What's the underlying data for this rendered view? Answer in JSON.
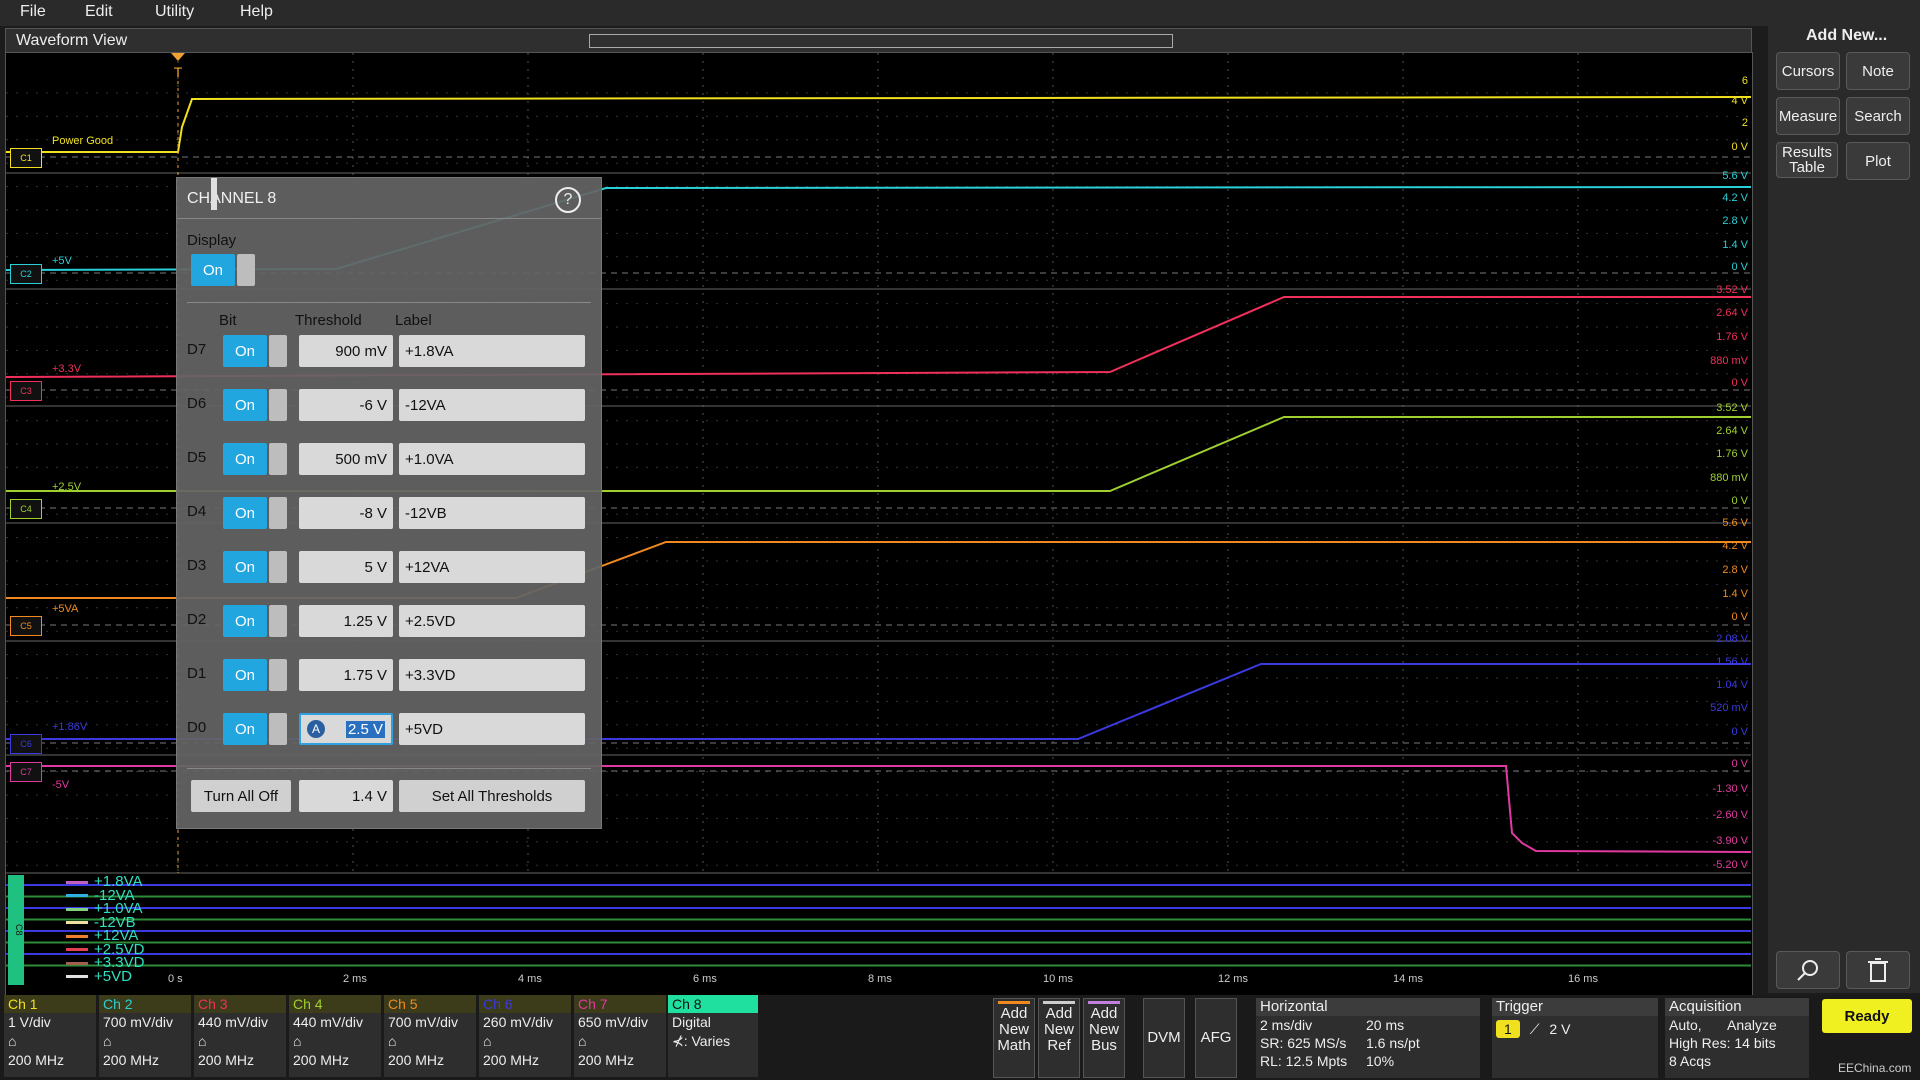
{
  "menu": {
    "items": [
      "File",
      "Edit",
      "Utility",
      "Help"
    ]
  },
  "waveform_view": {
    "title": "Waveform View",
    "trigger_marker": "T",
    "channel_labels": [
      {
        "badge": "C1",
        "name": "Power Good",
        "color": "#f0e020"
      },
      {
        "badge": "C2",
        "name": "+5V",
        "color": "#2ad0d8"
      },
      {
        "badge": "C3",
        "name": "+3.3V",
        "color": "#f0305a"
      },
      {
        "badge": "C4",
        "name": "+2.5V",
        "color": "#9fd030"
      },
      {
        "badge": "C5",
        "name": "+5VA",
        "color": "#f08a20"
      },
      {
        "badge": "C6",
        "name": "+1.86V",
        "color": "#3a3ae0"
      },
      {
        "badge": "C7",
        "name": "-5V",
        "color": "#e03aa0"
      }
    ],
    "scales": [
      [
        "6",
        "4 V",
        "2",
        "0 V"
      ],
      [
        "5.6 V",
        "4.2 V",
        "2.8 V",
        "1.4 V",
        "0 V"
      ],
      [
        "3.52 V",
        "2.64 V",
        "1.76 V",
        "880 mV",
        "0 V"
      ],
      [
        "3.52 V",
        "2.64 V",
        "1.76 V",
        "880 mV",
        "0 V"
      ],
      [
        "5.6 V",
        "4.2 V",
        "2.8 V",
        "1.4 V",
        "0 V"
      ],
      [
        "2.08 V",
        "1.56 V",
        "1.04 V",
        "520 mV",
        "0 V"
      ],
      [
        "0 V",
        "-1.30 V",
        "-2.60 V",
        "-3.90 V",
        "-5.20 V"
      ]
    ],
    "time_labels": [
      "0 s",
      "2 ms",
      "4 ms",
      "6 ms",
      "8 ms",
      "10 ms",
      "12 ms",
      "14 ms",
      "16 ms"
    ],
    "digital_group_badge": "C8",
    "digital_labels": [
      "+1.8VA",
      "-12VA",
      "+1.0VA",
      "-12VB",
      "+12VA",
      "+2.5VD",
      "+3.3VD",
      "+5VD"
    ],
    "colors": {
      "ch1": "#f0e020",
      "ch2": "#2ad0d8",
      "ch3": "#f0305a",
      "ch4": "#9fd030",
      "ch5": "#f08a20",
      "ch6": "#3a3ae0",
      "ch7": "#e03aa0",
      "digital": "#3a3ae0",
      "digital_green": "#2e8b3a",
      "grid": "#555555"
    }
  },
  "channel8_dialog": {
    "title": "CHANNEL 8",
    "help_glyph": "?",
    "display_label": "Display",
    "display_state": "On",
    "col_bit": "Bit",
    "col_threshold": "Threshold",
    "col_label": "Label",
    "rows": [
      {
        "bit": "D7",
        "state": "On",
        "threshold": "900 mV",
        "label": "+1.8VA",
        "color": "#c060c0"
      },
      {
        "bit": "D6",
        "state": "On",
        "threshold": "-6 V",
        "label": "-12VA",
        "color": "#30b0e0"
      },
      {
        "bit": "D5",
        "state": "On",
        "threshold": "500 mV",
        "label": "+1.0VA",
        "color": "#80d080"
      },
      {
        "bit": "D4",
        "state": "On",
        "threshold": "-8 V",
        "label": "-12VB",
        "color": "#f0e0a0"
      },
      {
        "bit": "D3",
        "state": "On",
        "threshold": "5 V",
        "label": "+12VA",
        "color": "#f08030"
      },
      {
        "bit": "D2",
        "state": "On",
        "threshold": "1.25 V",
        "label": "+2.5VD",
        "color": "#e04050"
      },
      {
        "bit": "D1",
        "state": "On",
        "threshold": "1.75 V",
        "label": "+3.3VD",
        "color": "#a06050"
      },
      {
        "bit": "D0",
        "state": "On",
        "threshold": "2.5 V",
        "label": "+5VD",
        "color": "#e0e0e0"
      }
    ],
    "turn_all_off": "Turn All Off",
    "all_threshold": "1.4 V",
    "set_all_thresholds": "Set All Thresholds",
    "edit_badge": "A"
  },
  "right_panel": {
    "title": "Add New...",
    "buttons": [
      "Cursors",
      "Note",
      "Measure",
      "Search",
      "Results Table",
      "Plot"
    ]
  },
  "bottom_bar": {
    "channels": [
      {
        "name": "Ch 1",
        "vdiv": "1 V/div",
        "bw": "200 MHz",
        "color": "#f0e020"
      },
      {
        "name": "Ch 2",
        "vdiv": "700 mV/div",
        "bw": "200 MHz",
        "color": "#2ad0d8"
      },
      {
        "name": "Ch 3",
        "vdiv": "440 mV/div",
        "bw": "200 MHz",
        "color": "#f0305a"
      },
      {
        "name": "Ch 4",
        "vdiv": "440 mV/div",
        "bw": "200 MHz",
        "color": "#9fd030"
      },
      {
        "name": "Ch 5",
        "vdiv": "700 mV/div",
        "bw": "200 MHz",
        "color": "#f08a20"
      },
      {
        "name": "Ch 6",
        "vdiv": "260 mV/div",
        "bw": "200 MHz",
        "color": "#3a3ae0"
      },
      {
        "name": "Ch 7",
        "vdiv": "650 mV/div",
        "bw": "200 MHz",
        "color": "#e03aa0"
      }
    ],
    "ch8": {
      "name": "Ch 8",
      "line1": "Digital",
      "line2": "⊀: Varies",
      "color": "#20e0a0"
    },
    "add_buttons": [
      {
        "lines": "Add New Math",
        "color": "#f08a20"
      },
      {
        "lines": "Add New Ref",
        "color": "#cccccc"
      },
      {
        "lines": "Add New Bus",
        "color": "#c080e0"
      }
    ],
    "dvm": "DVM",
    "afg": "AFG",
    "horizontal": {
      "title": "Horizontal",
      "row1a": "2 ms/div",
      "row1b": "20 ms",
      "row2a": "SR: 625 MS/s",
      "row2b": "1.6 ns/pt",
      "row3a": "RL: 12.5 Mpts",
      "row3b": "10%"
    },
    "trigger": {
      "title": "Trigger",
      "source": "1",
      "level": "2 V"
    },
    "acquisition": {
      "title": "Acquisition",
      "row1a": "Auto,",
      "row1b": "Analyze",
      "row2": "High Res: 14 bits",
      "row3": "8 Acqs"
    },
    "ready": "Ready",
    "watermark": "EEChina.com"
  }
}
